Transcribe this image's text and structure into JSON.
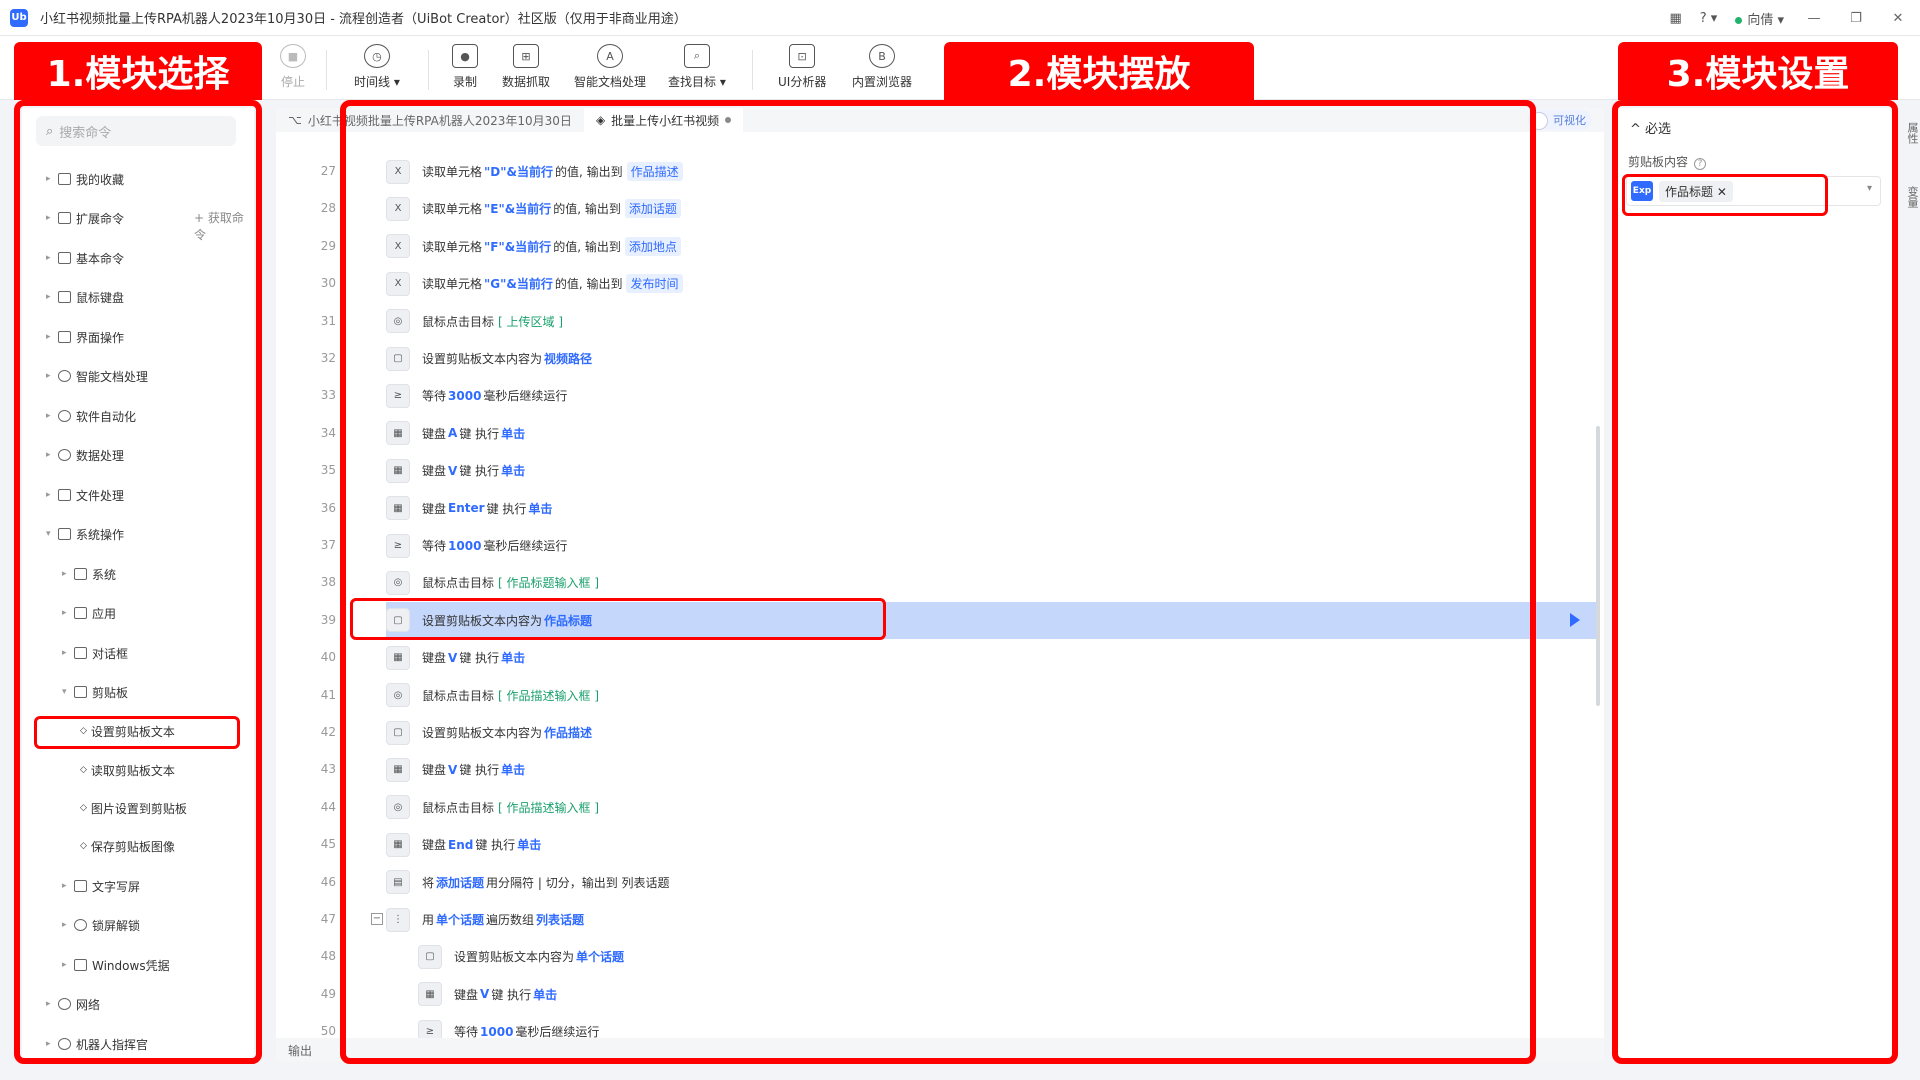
{
  "window": {
    "title": "小红书视频批量上传RPA机器人2023年10月30日 - 流程创造者（UiBot Creator）社区版（仅用于非商业用途）",
    "user": "向倩",
    "logo": "Ub"
  },
  "toolbar": {
    "stop": "停止",
    "timeline": "时间线 ▾",
    "record": "录制",
    "data_scrape": "数据抓取",
    "smart_doc": "智能文档处理",
    "find_target": "查找目标 ▾",
    "ui_analyzer": "UI分析器",
    "builtin_browser": "内置浏览器"
  },
  "annotations": {
    "label1": "1.模块选择",
    "label2": "2.模块摆放",
    "label3": "3.模块设置"
  },
  "sidebar": {
    "search_placeholder": "搜索命令",
    "fetch_command": "+ 获取命令",
    "items": [
      {
        "label": "我的收藏"
      },
      {
        "label": "扩展命令"
      },
      {
        "label": "基本命令"
      },
      {
        "label": "鼠标键盘"
      },
      {
        "label": "界面操作"
      },
      {
        "label": "智能文档处理"
      },
      {
        "label": "软件自动化"
      },
      {
        "label": "数据处理"
      },
      {
        "label": "文件处理"
      },
      {
        "label": "系统操作"
      },
      {
        "label": "系统"
      },
      {
        "label": "应用"
      },
      {
        "label": "对话框"
      },
      {
        "label": "剪贴板"
      },
      {
        "label": "设置剪贴板文本"
      },
      {
        "label": "读取剪贴板文本"
      },
      {
        "label": "图片设置到剪贴板"
      },
      {
        "label": "保存剪贴板图像"
      },
      {
        "label": "文字写屏"
      },
      {
        "label": "锁屏解锁"
      },
      {
        "label": "Windows凭据"
      },
      {
        "label": "网络"
      },
      {
        "label": "机器人指挥官"
      }
    ]
  },
  "editor": {
    "breadcrumb": "小红书视频批量上传RPA机器人2023年10月30日",
    "active_tab": "批量上传小红书视频",
    "visualize_toggle": "可视化",
    "output_label": "输出",
    "rows": [
      {
        "line": "27",
        "icon": "X",
        "pre": "读取单元格 ",
        "kw": "\"D\"&当前行",
        "mid": " 的值, 输出到",
        "tag": "作品描述",
        "green": ""
      },
      {
        "line": "28",
        "icon": "X",
        "pre": "读取单元格 ",
        "kw": "\"E\"&当前行",
        "mid": " 的值, 输出到",
        "tag": "添加话题",
        "green": ""
      },
      {
        "line": "29",
        "icon": "X",
        "pre": "读取单元格 ",
        "kw": "\"F\"&当前行",
        "mid": " 的值, 输出到",
        "tag": "添加地点",
        "green": ""
      },
      {
        "line": "30",
        "icon": "X",
        "pre": "读取单元格 ",
        "kw": "\"G\"&当前行",
        "mid": " 的值, 输出到",
        "tag": "发布时间",
        "green": ""
      },
      {
        "line": "31",
        "icon": "◎",
        "pre": "鼠标点击目标",
        "kw": "",
        "mid": "",
        "tag": "",
        "green": "[ 上传区域   ]"
      },
      {
        "line": "32",
        "icon": "▢",
        "pre": "设置剪贴板文本内容为",
        "kw": "视频路径",
        "mid": "",
        "tag": "",
        "green": ""
      },
      {
        "line": "33",
        "icon": "≥",
        "pre": "等待",
        "kw": "3000",
        "mid": "毫秒后继续运行",
        "tag": "",
        "green": ""
      },
      {
        "line": "34",
        "icon": "▦",
        "pre": "键盘",
        "kw": "A",
        "mid": "键 执行",
        "tag": "",
        "green": "",
        "kw2": "单击"
      },
      {
        "line": "35",
        "icon": "▦",
        "pre": "键盘",
        "kw": "V",
        "mid": "键 执行",
        "tag": "",
        "green": "",
        "kw2": "单击"
      },
      {
        "line": "36",
        "icon": "▦",
        "pre": "键盘",
        "kw": "Enter",
        "mid": "键 执行",
        "tag": "",
        "green": "",
        "kw2": "单击"
      },
      {
        "line": "37",
        "icon": "≥",
        "pre": "等待",
        "kw": "1000",
        "mid": "毫秒后继续运行",
        "tag": "",
        "green": ""
      },
      {
        "line": "38",
        "icon": "◎",
        "pre": "鼠标点击目标",
        "kw": "",
        "mid": "",
        "tag": "",
        "green": "[ 作品标题输入框   ]"
      },
      {
        "line": "39",
        "icon": "▢",
        "pre": "设置剪贴板文本内容为",
        "kw": "作品标题",
        "mid": "",
        "tag": "",
        "green": "",
        "selected": true
      },
      {
        "line": "40",
        "icon": "▦",
        "pre": "键盘",
        "kw": "V",
        "mid": "键 执行",
        "tag": "",
        "green": "",
        "kw2": "单击"
      },
      {
        "line": "41",
        "icon": "◎",
        "pre": "鼠标点击目标",
        "kw": "",
        "mid": "",
        "tag": "",
        "green": "[ 作品描述输入框   ]"
      },
      {
        "line": "42",
        "icon": "▢",
        "pre": "设置剪贴板文本内容为",
        "kw": "作品描述",
        "mid": "",
        "tag": "",
        "green": ""
      },
      {
        "line": "43",
        "icon": "▦",
        "pre": "键盘",
        "kw": "V",
        "mid": "键 执行",
        "tag": "",
        "green": "",
        "kw2": "单击"
      },
      {
        "line": "44",
        "icon": "◎",
        "pre": "鼠标点击目标",
        "kw": "",
        "mid": "",
        "tag": "",
        "green": "[ 作品描述输入框   ]"
      },
      {
        "line": "45",
        "icon": "▦",
        "pre": "键盘",
        "kw": "End",
        "mid": "键 执行",
        "tag": "",
        "green": "",
        "kw2": "单击"
      },
      {
        "line": "46",
        "icon": "▤",
        "pre": "将",
        "kw": "添加话题",
        "mid": "用分隔符 | 切分，输出到 列表话题",
        "tag": "",
        "green": ""
      },
      {
        "line": "47",
        "icon": "⋮",
        "pre": "用",
        "kw": "单个话题",
        "mid": "遍历数组",
        "tag": "",
        "green": "",
        "kw2": "列表话题",
        "collapse": true
      },
      {
        "line": "48",
        "icon": "▢",
        "pre": "设置剪贴板文本内容为",
        "kw": "单个话题",
        "mid": "",
        "tag": "",
        "green": "",
        "indent": true
      },
      {
        "line": "49",
        "icon": "▦",
        "pre": "键盘",
        "kw": "V",
        "mid": "键 执行",
        "tag": "",
        "green": "",
        "kw2": "单击",
        "indent": true
      },
      {
        "line": "50",
        "icon": "≥",
        "pre": "等待",
        "kw": "1000",
        "mid": "毫秒后继续运行",
        "tag": "",
        "green": "",
        "indent": true
      }
    ]
  },
  "properties": {
    "section": "必选",
    "field_label": "剪贴板内容",
    "expr_badge": "Exp",
    "value_chip": "作品标题",
    "side_tab_top": "属性",
    "side_tab_bottom": "变量"
  },
  "colors": {
    "accent": "#2f6bff",
    "highlight_red": "#ff0000",
    "selected_row": "#c5d7fb",
    "target_green": "#1aa06d"
  }
}
